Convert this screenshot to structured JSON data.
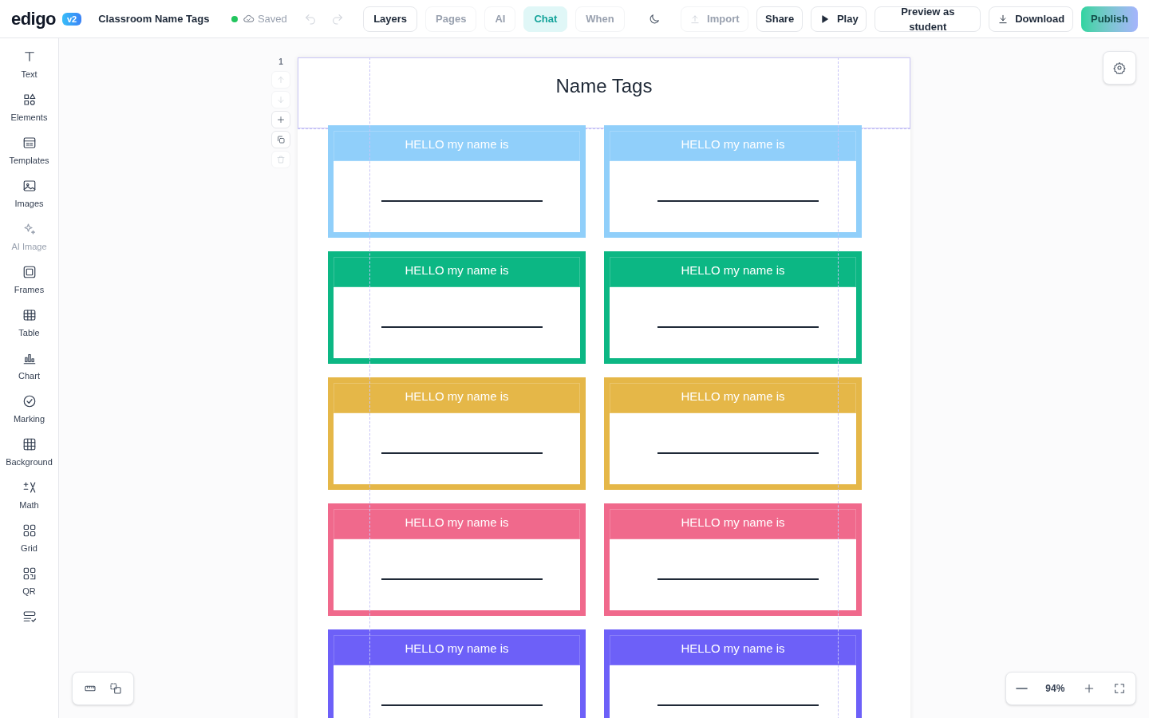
{
  "header": {
    "logo": "edigo",
    "version": "v2",
    "doc_title": "Classroom Name Tags",
    "save_status": "Saved",
    "tabs": [
      {
        "label": "Layers",
        "selected": false,
        "disabled": false
      },
      {
        "label": "Pages",
        "selected": false,
        "disabled": true
      },
      {
        "label": "AI",
        "selected": false,
        "disabled": true
      },
      {
        "label": "Chat",
        "selected": true,
        "disabled": false
      },
      {
        "label": "When",
        "selected": false,
        "disabled": true
      }
    ],
    "actions": [
      {
        "kind": "import",
        "label": "Import",
        "disabled": true
      },
      {
        "kind": "share",
        "label": "Share",
        "disabled": false
      },
      {
        "kind": "play",
        "label": "Play",
        "disabled": false
      },
      {
        "kind": "preview",
        "label": "Preview as student",
        "disabled": false
      },
      {
        "kind": "download",
        "label": "Download",
        "disabled": false
      }
    ],
    "publish": "Publish"
  },
  "sidebar": {
    "items": [
      {
        "kind": "text",
        "label": "Text",
        "disabled": false
      },
      {
        "kind": "elements",
        "label": "Elements",
        "disabled": false
      },
      {
        "kind": "templates",
        "label": "Templates",
        "disabled": false
      },
      {
        "kind": "images",
        "label": "Images",
        "disabled": false
      },
      {
        "kind": "ai",
        "label": "AI Image",
        "disabled": true
      },
      {
        "kind": "frames",
        "label": "Frames",
        "disabled": false
      },
      {
        "kind": "table",
        "label": "Table",
        "disabled": false
      },
      {
        "kind": "chart",
        "label": "Chart",
        "disabled": false
      },
      {
        "kind": "marking",
        "label": "Marking",
        "disabled": false
      },
      {
        "kind": "background",
        "label": "Background",
        "disabled": false
      },
      {
        "kind": "math",
        "label": "Math",
        "disabled": false
      },
      {
        "kind": "grid",
        "label": "Grid",
        "disabled": false
      },
      {
        "kind": "qr",
        "label": "QR",
        "disabled": false
      },
      {
        "kind": "forms",
        "disabled": false
      }
    ]
  },
  "page": {
    "number": "1",
    "title": "Name Tags",
    "tags": [
      {
        "label": "HELLO my name is",
        "color": "#90cffa"
      },
      {
        "label": "HELLO my name is",
        "color": "#90cffa"
      },
      {
        "label": "HELLO my name is",
        "color": "#0cb784"
      },
      {
        "label": "HELLO my name is",
        "color": "#0cb784"
      },
      {
        "label": "HELLO my name is",
        "color": "#e5b748"
      },
      {
        "label": "HELLO my name is",
        "color": "#e5b748"
      },
      {
        "label": "HELLO my name is",
        "color": "#f0698c"
      },
      {
        "label": "HELLO my name is",
        "color": "#f0698c"
      },
      {
        "label": "HELLO my name is",
        "color": "#6d60f8"
      },
      {
        "label": "HELLO my name is",
        "color": "#6d60f8"
      }
    ]
  },
  "zoom": {
    "value": "94%"
  }
}
